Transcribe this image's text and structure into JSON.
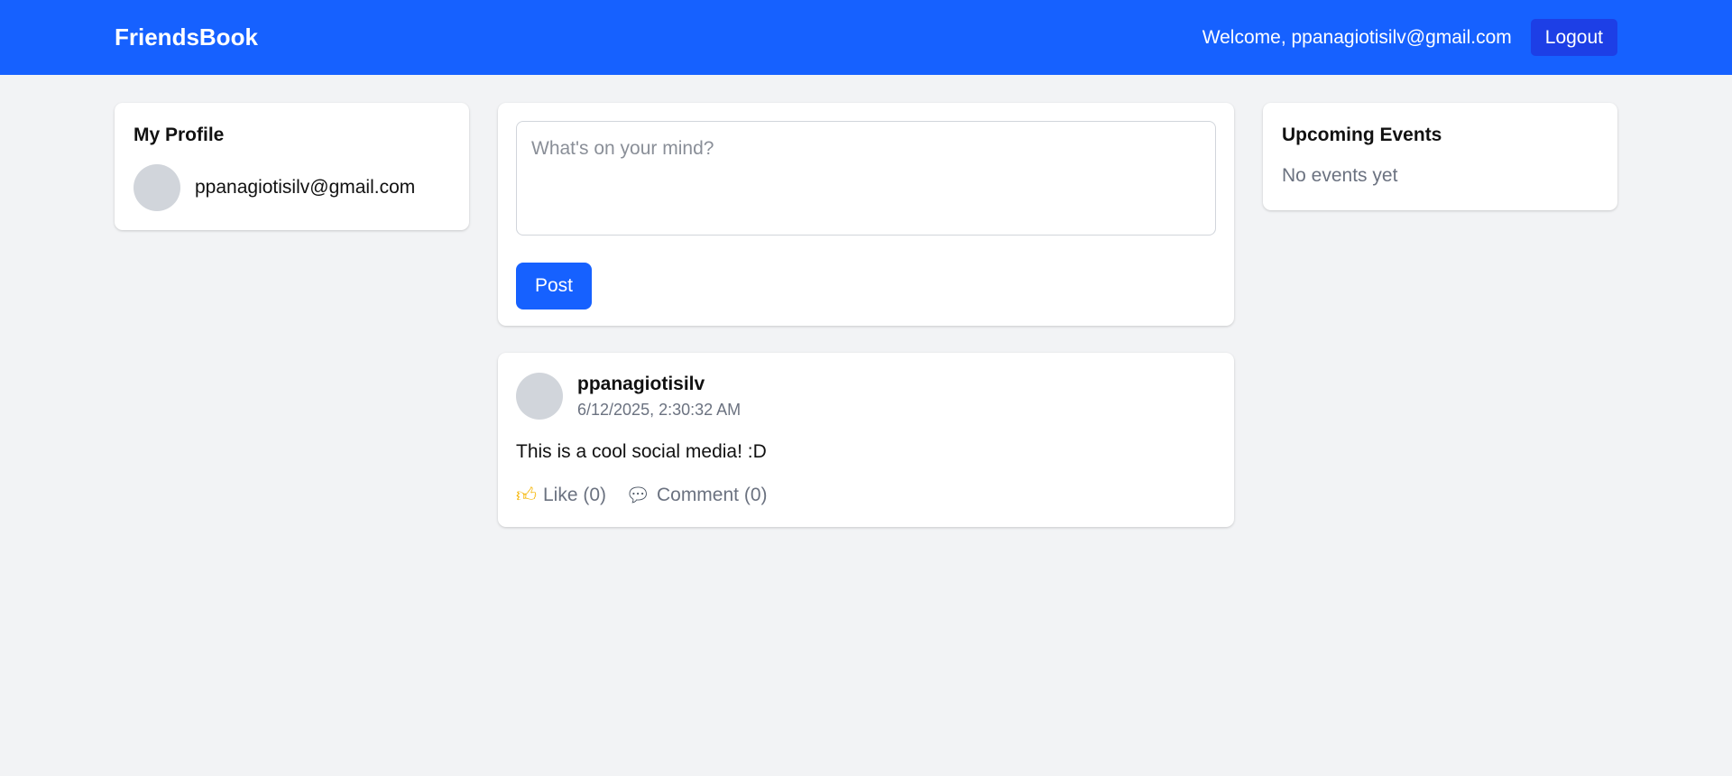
{
  "navbar": {
    "brand": "FriendsBook",
    "welcome_text": "Welcome, ppanagiotisilv@gmail.com",
    "logout_label": "Logout",
    "color": "#1661ff"
  },
  "profile": {
    "title": "My Profile",
    "email": "ppanagiotisilv@gmail.com"
  },
  "composer": {
    "placeholder": "What's on your mind?",
    "value": "",
    "post_label": "Post"
  },
  "posts": [
    {
      "author": "ppanagiotisilv",
      "timestamp": "6/12/2025, 2:30:32 AM",
      "content": "This is a cool social media! :D",
      "like_icon": "thumbs-up-icon",
      "like_label": "Like (0)",
      "comment_icon": "speech-bubble-icon",
      "comment_label": "Comment (0)"
    }
  ],
  "events": {
    "title": "Upcoming Events",
    "empty_text": "No events yet"
  }
}
